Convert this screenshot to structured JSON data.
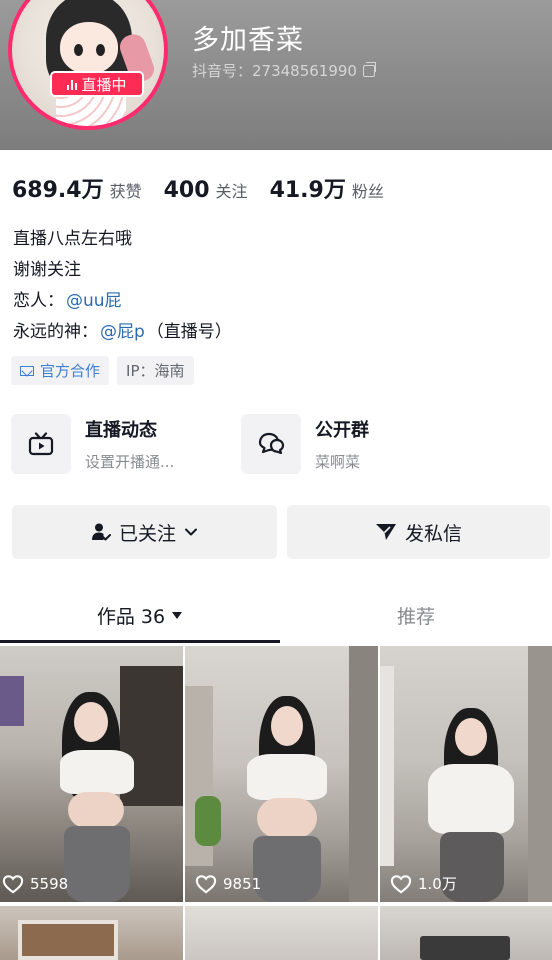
{
  "profile": {
    "nickname": "多加香菜",
    "account_id": "抖音号：27348561990",
    "live_badge": "直播中"
  },
  "stats": [
    {
      "value": "689.4万",
      "label": "获赞"
    },
    {
      "value": "400",
      "label": "关注"
    },
    {
      "value": "41.9万",
      "label": "粉丝"
    }
  ],
  "bio": {
    "line1": "直播八点左右哦",
    "line2": "谢谢关注",
    "line3_prefix": "恋人：",
    "line3_mention": "@uu屁",
    "line4_prefix": "永远的神：",
    "line4_mention": "@屁p",
    "line4_suffix": "（直播号）"
  },
  "tags": {
    "cooperation": "官方合作",
    "ip": "IP：海南"
  },
  "features": [
    {
      "title": "直播动态",
      "subtitle": "设置开播通...",
      "icon": "tv-icon"
    },
    {
      "title": "公开群",
      "subtitle": "菜啊菜",
      "icon": "chat-group-icon"
    }
  ],
  "actions": {
    "follow": "已关注",
    "message": "发私信"
  },
  "tabs": {
    "works": "作品 36",
    "recommend": "推荐"
  },
  "videos": [
    {
      "likes": "5598"
    },
    {
      "likes": "9851"
    },
    {
      "likes": "1.0万"
    }
  ],
  "colors": {
    "live_red": "#fe2c55",
    "link_blue": "#2b6cb0"
  }
}
